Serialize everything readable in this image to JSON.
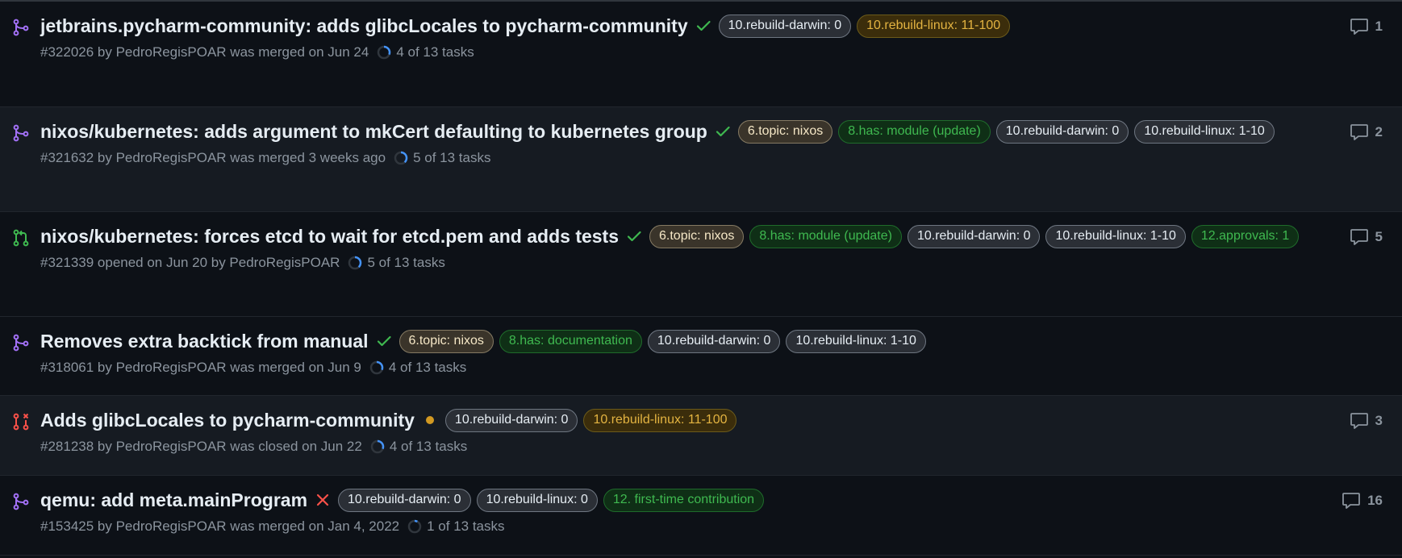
{
  "colors": {
    "merged": "#a371f7",
    "open": "#3fb950",
    "closed": "#f85149",
    "check": "#3fb950",
    "pending": "#d29922",
    "fail": "#f85149",
    "progress": "#4493f8"
  },
  "pull_requests": [
    {
      "state": "merged",
      "state_icon": "git-merge-icon",
      "title": "jetbrains.pycharm-community: adds glibcLocales to pycharm-community",
      "status_icon": "check-icon",
      "labels": [
        {
          "text": "10.rebuild-darwin: 0",
          "color": "gray"
        },
        {
          "text": "10.rebuild-linux: 11-100",
          "color": "yellow"
        }
      ],
      "meta": "#322026 by PedroRegisPOAR was merged on Jun 24",
      "tasks": "4 of 13 tasks",
      "tasks_progress": 0.31,
      "comments": "1"
    },
    {
      "state": "merged",
      "state_icon": "git-merge-icon",
      "title": "nixos/kubernetes: adds argument to mkCert defaulting to kubernetes group",
      "status_icon": "check-icon",
      "labels": [
        {
          "text": "6.topic: nixos",
          "color": "beige"
        },
        {
          "text": "8.has: module (update)",
          "color": "green"
        },
        {
          "text": "10.rebuild-darwin: 0",
          "color": "gray"
        },
        {
          "text": "10.rebuild-linux: 1-10",
          "color": "gray"
        }
      ],
      "meta": "#321632 by PedroRegisPOAR was merged 3 weeks ago",
      "tasks": "5 of 13 tasks",
      "tasks_progress": 0.38,
      "comments": "2"
    },
    {
      "state": "open",
      "state_icon": "git-pull-request-icon",
      "title": "nixos/kubernetes: forces etcd to wait for etcd.pem and adds tests",
      "status_icon": "check-icon",
      "labels": [
        {
          "text": "6.topic: nixos",
          "color": "beige"
        },
        {
          "text": "8.has: module (update)",
          "color": "green"
        },
        {
          "text": "10.rebuild-darwin: 0",
          "color": "gray"
        },
        {
          "text": "10.rebuild-linux: 1-10",
          "color": "gray"
        },
        {
          "text": "12.approvals: 1",
          "color": "green"
        }
      ],
      "meta": "#321339 opened on Jun 20 by PedroRegisPOAR",
      "tasks": "5 of 13 tasks",
      "tasks_progress": 0.38,
      "comments": "5"
    },
    {
      "state": "merged",
      "state_icon": "git-merge-icon",
      "title": "Removes extra backtick from manual",
      "status_icon": "check-icon",
      "labels": [
        {
          "text": "6.topic: nixos",
          "color": "beige"
        },
        {
          "text": "8.has: documentation",
          "color": "green"
        },
        {
          "text": "10.rebuild-darwin: 0",
          "color": "gray"
        },
        {
          "text": "10.rebuild-linux: 1-10",
          "color": "gray"
        }
      ],
      "meta": "#318061 by PedroRegisPOAR was merged on Jun 9",
      "tasks": "4 of 13 tasks",
      "tasks_progress": 0.31,
      "comments": ""
    },
    {
      "state": "closed",
      "state_icon": "git-pull-request-closed-icon",
      "title": "Adds glibcLocales to pycharm-community",
      "status_icon": "pending-dot-icon",
      "labels": [
        {
          "text": "10.rebuild-darwin: 0",
          "color": "gray"
        },
        {
          "text": "10.rebuild-linux: 11-100",
          "color": "yellow"
        }
      ],
      "meta": "#281238 by PedroRegisPOAR was closed on Jun 22",
      "tasks": "4 of 13 tasks",
      "tasks_progress": 0.31,
      "comments": "3"
    },
    {
      "state": "merged",
      "state_icon": "git-merge-icon",
      "title": "qemu: add meta.mainProgram",
      "status_icon": "x-icon",
      "labels": [
        {
          "text": "10.rebuild-darwin: 0",
          "color": "gray"
        },
        {
          "text": "10.rebuild-linux: 0",
          "color": "gray"
        },
        {
          "text": "12. first-time contribution",
          "color": "green"
        }
      ],
      "meta": "#153425 by PedroRegisPOAR was merged on Jan 4, 2022",
      "tasks": "1 of 13 tasks",
      "tasks_progress": 0.08,
      "comments": "16"
    }
  ]
}
